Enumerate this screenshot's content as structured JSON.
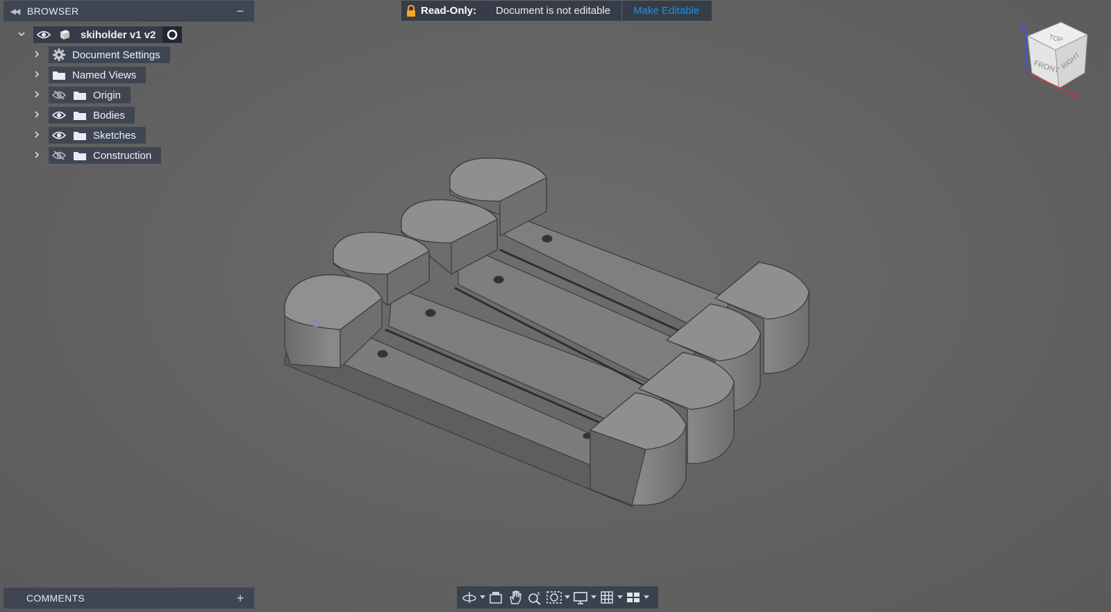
{
  "browser": {
    "title": "BROWSER",
    "collapse_icon": "double-chevron-left-icon",
    "minimize_icon": "minus-icon",
    "root": {
      "label": "skiholder v1 v2",
      "icons": [
        "chevron-down-icon",
        "eye-icon",
        "component-cube-icon",
        "active-radio-icon"
      ]
    },
    "items": [
      {
        "label": "Document Settings",
        "icon": "gear-icon",
        "visibility": null
      },
      {
        "label": "Named Views",
        "icon": "folder-icon",
        "visibility": null
      },
      {
        "label": "Origin",
        "icon": "folder-icon",
        "visibility": "hidden"
      },
      {
        "label": "Bodies",
        "icon": "folder-icon",
        "visibility": "visible"
      },
      {
        "label": "Sketches",
        "icon": "folder-icon",
        "visibility": "visible"
      },
      {
        "label": "Construction",
        "icon": "folder-icon",
        "visibility": "hidden"
      }
    ]
  },
  "banner": {
    "lock_icon": "lock-icon",
    "label": "Read-Only:",
    "message": "Document is not editable",
    "action": "Make Editable",
    "link_color": "#1d8fe0"
  },
  "viewcube": {
    "top": "TOP",
    "front": "FRONT",
    "right": "RIGHT",
    "axis_z": "Z",
    "axis_x": "X",
    "z_color": "#3d55d9",
    "x_color": "#e03030"
  },
  "comments": {
    "title": "COMMENTS",
    "add_icon": "plus-icon"
  },
  "navbar": {
    "tools": [
      "orbit-icon",
      "look-at-icon",
      "pan-hand-icon",
      "zoom-icon",
      "fit-window-icon",
      "display-settings-icon",
      "grid-icon",
      "viewports-icon"
    ]
  }
}
